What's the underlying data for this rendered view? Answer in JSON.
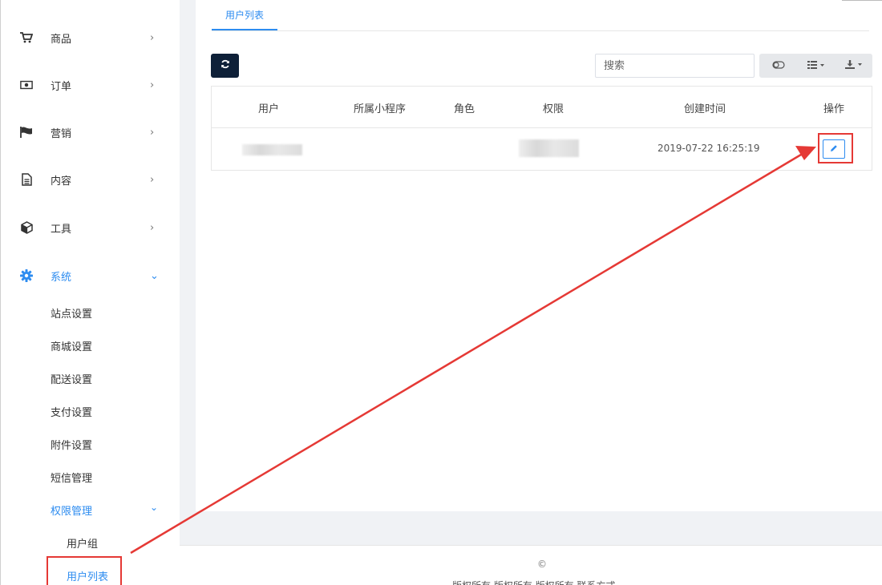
{
  "sidebar": {
    "items": [
      {
        "label": "商品",
        "chevron": "›",
        "icon": "cart-icon"
      },
      {
        "label": "订单",
        "chevron": "›",
        "icon": "money-icon"
      },
      {
        "label": "营销",
        "chevron": "›",
        "icon": "flag-icon"
      },
      {
        "label": "内容",
        "chevron": "›",
        "icon": "document-icon"
      },
      {
        "label": "工具",
        "chevron": "›",
        "icon": "cube-icon"
      },
      {
        "label": "系统",
        "chevron": "⌄",
        "icon": "gear-icon"
      }
    ],
    "system_sub": [
      "站点设置",
      "商城设置",
      "配送设置",
      "支付设置",
      "附件设置",
      "短信管理"
    ],
    "permission": {
      "label": "权限管理",
      "chevron": "⌄"
    },
    "permission_sub": [
      "用户组",
      "用户列表"
    ]
  },
  "tabs": [
    {
      "label": "用户列表"
    }
  ],
  "toolbar": {
    "search_placeholder": "搜索",
    "toggle_icon": "toggle-icon",
    "columns_icon": "columns-icon",
    "export_icon": "download-icon"
  },
  "table": {
    "headers": [
      "用户",
      "所属小程序",
      "角色",
      "权限",
      "创建时间",
      "操作"
    ],
    "rows": [
      {
        "user": "",
        "program": "",
        "role": "",
        "permission": "",
        "created": "2019-07-22 16:25:19",
        "action_icon": "pencil-icon"
      }
    ]
  },
  "footer": {
    "copyright": "©",
    "text": "版权所有 版权所有 版权所有 联系方式"
  },
  "colors": {
    "accent": "#2d8cf0",
    "dark_button": "#0e2038",
    "annotation": "#e53935"
  }
}
